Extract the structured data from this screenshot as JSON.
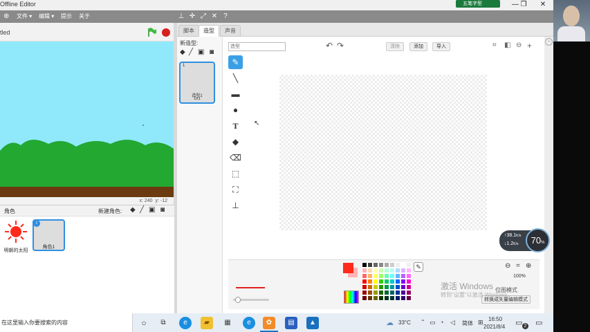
{
  "window": {
    "title": "Offline Editor",
    "badge": "五笔字型",
    "controls": [
      "—",
      "❐",
      "✕"
    ]
  },
  "menubar": {
    "menus": [
      "文件 ▾",
      "编辑 ▾",
      "提示",
      "关于"
    ],
    "tools": [
      "stamp-icon",
      "grow-icon",
      "expand-icon",
      "shrink-icon",
      "help-icon"
    ]
  },
  "stage": {
    "project_title": "tled",
    "coords_x_label": "x:",
    "coords_x": "240",
    "coords_y_label": "y:",
    "coords_y": "-12",
    "sky_color": "#8fe9fb",
    "hills_color": "#22aa33",
    "ground_color": "#6b3a10"
  },
  "sprites": {
    "header_left": "角色",
    "new_sprite_label": "新建角色:",
    "items": [
      {
        "name": "明朝的太阳"
      },
      {
        "name": "角色1"
      }
    ]
  },
  "tabs": [
    {
      "label": "脚本"
    },
    {
      "label": "造型"
    },
    {
      "label": "声音"
    }
  ],
  "costumes": {
    "new_label": "新造型:",
    "items": [
      {
        "index": "1",
        "name": "造型1",
        "size": "1x1"
      }
    ]
  },
  "editor": {
    "costume_name_placeholder": "造型",
    "clear_label": "清除",
    "add_label": "添加",
    "import_label": "导入",
    "zoom_level": "100%",
    "bitmap_mode_label": "位图模式",
    "convert_label": "转换成矢量编辑模式",
    "paint_tools": [
      "brush-icon",
      "line-icon",
      "rectangle-icon",
      "ellipse-icon",
      "text-icon",
      "fill-icon",
      "eraser-icon",
      "select-icon",
      "select-remove-background-icon",
      "stamp-icon"
    ],
    "primary_color": "#ff2a1a",
    "line_color": "#e02020",
    "palette": [
      "#000000",
      "#404040",
      "#666666",
      "#888888",
      "#aaaaaa",
      "#cccccc",
      "#eeeeee",
      "#ffffff",
      "#f0f0f0",
      "#ffb3b3",
      "#ffd9b3",
      "#ffffb3",
      "#ccffb3",
      "#b3ffd9",
      "#b3ffff",
      "#b3d9ff",
      "#d9b3ff",
      "#ffb3ff",
      "#ff6666",
      "#ffb366",
      "#ffff66",
      "#99ff66",
      "#66ffb3",
      "#66ffff",
      "#66b3ff",
      "#b366ff",
      "#ff66ff",
      "#ff0000",
      "#ff8000",
      "#ffff00",
      "#33cc00",
      "#00cc66",
      "#00cccc",
      "#0066ff",
      "#8000ff",
      "#ff00cc",
      "#cc0000",
      "#cc6600",
      "#cccc00",
      "#269900",
      "#009950",
      "#009999",
      "#004dcc",
      "#6600cc",
      "#cc0099",
      "#990000",
      "#994d00",
      "#999900",
      "#1a6600",
      "#006633",
      "#006666",
      "#003399",
      "#4d0099",
      "#990066",
      "#660000",
      "#663300",
      "#666600",
      "#0d3300",
      "#00331a",
      "#003333",
      "#001a66",
      "#330066",
      "#660044"
    ]
  },
  "network": {
    "up": "38.1",
    "up_unit": "K/s",
    "down": "1.2",
    "down_unit": "K/s",
    "percent": "70",
    "percent_unit": "%"
  },
  "watermark": {
    "line1": "激活 Windows",
    "line2": "转到\"设置\"以激活 Windows。"
  },
  "taskbar": {
    "search_placeholder": "在这里输入你要搜索的内容",
    "weather": "33°C",
    "ime": "简体",
    "time": "16:50",
    "date": "2021/8/4",
    "notification_count": "2"
  }
}
